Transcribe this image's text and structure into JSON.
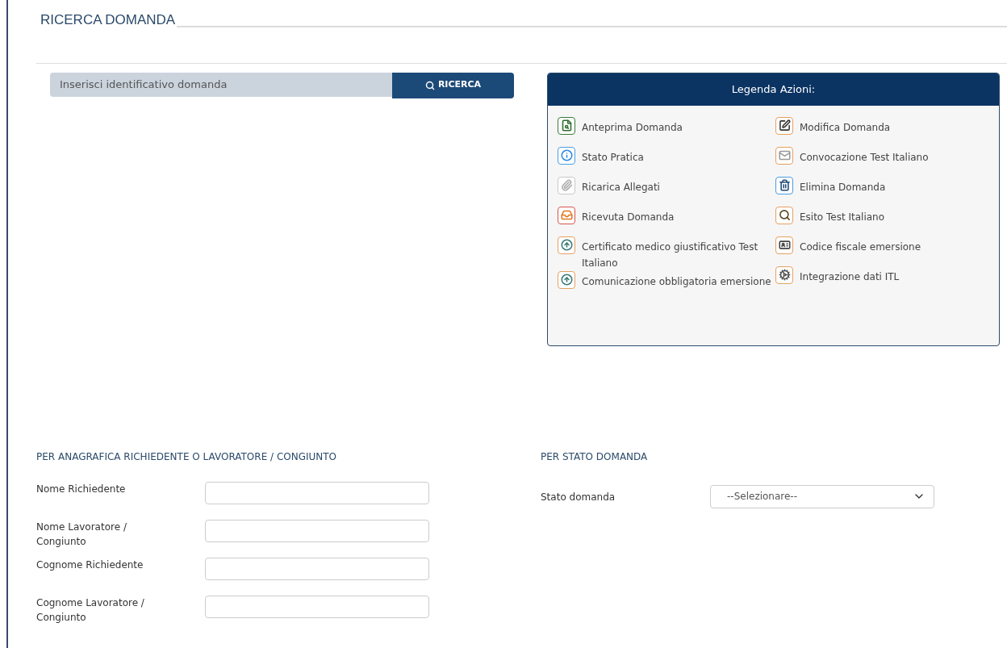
{
  "page_title": "RICERCA DOMANDA",
  "search": {
    "placeholder": "Inserisci identificativo domanda",
    "button": "RICERCA"
  },
  "legend": {
    "title": "Legenda Azioni:",
    "left": [
      {
        "kind": "preview",
        "color": "#3a7a3a",
        "label": "Anteprima Domanda"
      },
      {
        "kind": "info",
        "color": "#4a9ee0",
        "label": "Stato Pratica"
      },
      {
        "kind": "attachment",
        "color": "#c8c8c8",
        "label": "Ricarica Allegati"
      },
      {
        "kind": "receipt",
        "color": "#d9534f",
        "label": "Ricevuta Domanda"
      },
      {
        "kind": "upload",
        "color": "#e8a060",
        "label": "Certificato medico giustificativo Test Italiano"
      },
      {
        "kind": "upload",
        "color": "#e8a060",
        "label": "Comunicazione obbligatoria emersione"
      }
    ],
    "right": [
      {
        "kind": "edit",
        "color": "#e8a060",
        "label": "Modifica Domanda"
      },
      {
        "kind": "mail",
        "color": "#e8a060",
        "label": "Convocazione Test Italiano"
      },
      {
        "kind": "trash",
        "color": "#4a9ee0",
        "label": "Elimina Domanda"
      },
      {
        "kind": "search",
        "color": "#e8a060",
        "label": "Esito Test Italiano"
      },
      {
        "kind": "idcard",
        "color": "#e8a060",
        "label": "Codice fiscale emersione"
      },
      {
        "kind": "gear",
        "color": "#e8a060",
        "label": "Integrazione dati ITL"
      }
    ]
  },
  "person_section": {
    "heading": "PER ANAGRAFICA RICHIEDENTE O LAVORATORE / CONGIUNTO",
    "fields": [
      {
        "label": "Nome Richiedente"
      },
      {
        "label": "Nome Lavoratore / Congiunto"
      },
      {
        "label": "Cognome Richiedente"
      },
      {
        "label": "Cognome Lavoratore / Congiunto"
      }
    ]
  },
  "status_section": {
    "heading": "PER STATO DOMANDA",
    "field": {
      "label": "Stato domanda",
      "value": "--Selezionare--"
    }
  }
}
